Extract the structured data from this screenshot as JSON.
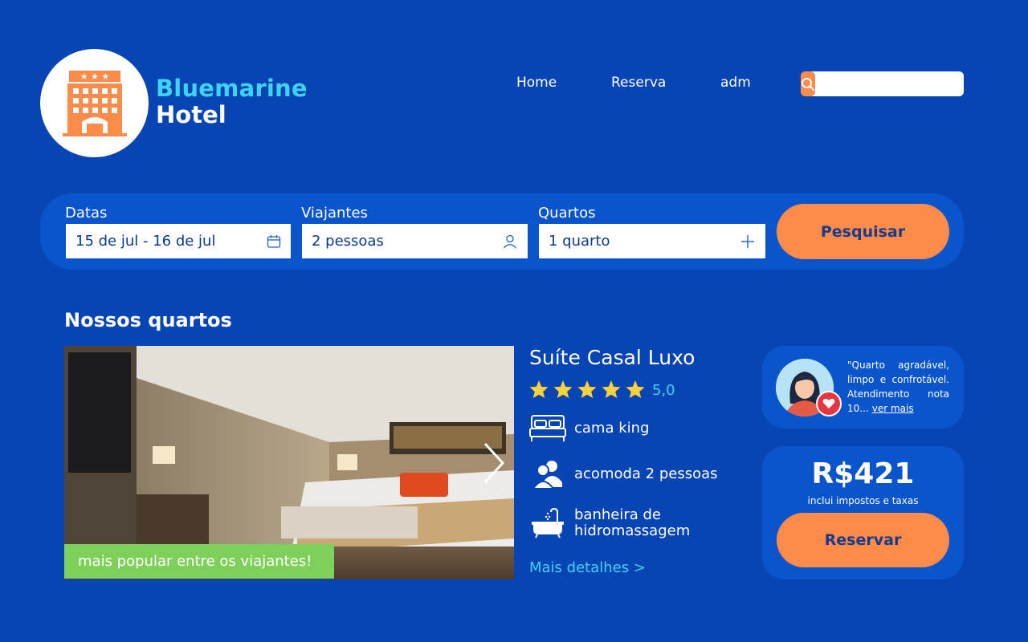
{
  "brand": {
    "line1": "Bluemarine",
    "line2": "Hotel",
    "logo_icon": "hotel-building-icon"
  },
  "nav": {
    "home": "Home",
    "reserva": "Reserva",
    "adm": "adm"
  },
  "search_bar": {
    "placeholder": "",
    "icon": "search-icon"
  },
  "booking": {
    "dates_label": "Datas",
    "dates_value": "15 de jul - 16 de jul",
    "travelers_label": "Viajantes",
    "travelers_value": "2 pessoas",
    "rooms_label": "Quartos",
    "rooms_value": "1 quarto",
    "search_button": "Pesquisar"
  },
  "rooms": {
    "section_title": "Nossos quartos",
    "badge": "mais popular entre os viajantes!",
    "title": "Suíte Casal Luxo",
    "stars": 5,
    "rating": "5,0",
    "amenities": [
      {
        "icon": "bed-icon",
        "label": "cama king"
      },
      {
        "icon": "people-icon",
        "label": "acomoda 2 pessoas"
      },
      {
        "icon": "bathtub-icon",
        "label": "banheira de hidromassagem"
      }
    ],
    "details_link": "Mais detalhes >"
  },
  "review": {
    "text": "\"Quarto agradável, limpo e confrotável. Atendimento nota 10...",
    "link": "ver mais"
  },
  "price": {
    "value": "R$421",
    "note": "inclui impostos e taxas",
    "reserve_button": "Reservar"
  },
  "colors": {
    "background": "#0845b4",
    "panel": "#0a55cc",
    "accent": "#fd8b49",
    "cyan": "#3fd3f2",
    "badge": "#7ed05a"
  }
}
